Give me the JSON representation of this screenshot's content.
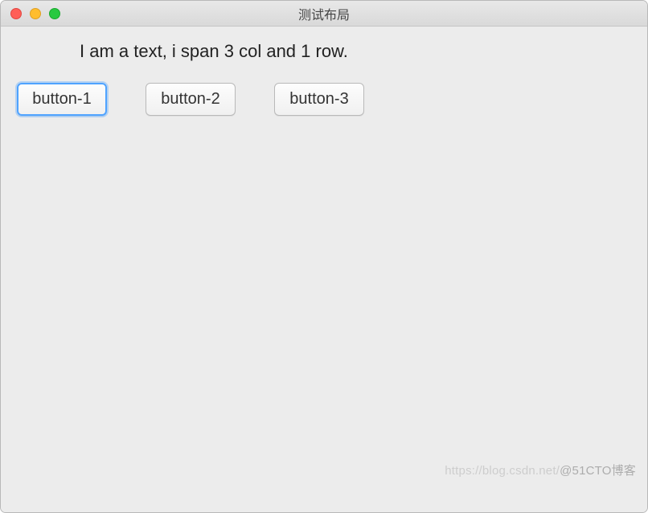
{
  "window": {
    "title": "测试布局"
  },
  "content": {
    "span_text": "I am a text, i span 3 col and 1 row.",
    "buttons": {
      "b1": "button-1",
      "b2": "button-2",
      "b3": "button-3"
    }
  },
  "watermark": {
    "faint": "https://blog.csdn.net/",
    "main": "@51CTO博客"
  }
}
